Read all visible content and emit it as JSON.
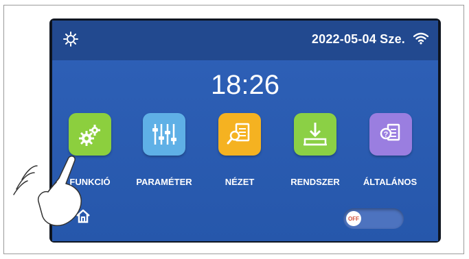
{
  "status_bar": {
    "datetime": "2022-05-04 Sze.",
    "left_icon": "sun-icon",
    "right_icon": "wifi-icon"
  },
  "clock": "18:26",
  "menu": [
    {
      "label": "FUNKCIÓ",
      "icon": "gears-icon",
      "color": "#8ccf3e"
    },
    {
      "label": "PARAMÉTER",
      "icon": "sliders-icon",
      "color": "#5fb0e6"
    },
    {
      "label": "NÉZET",
      "icon": "document-search-icon",
      "color": "#f5b221"
    },
    {
      "label": "RENDSZER",
      "icon": "download-tray-icon",
      "color": "#8bd045"
    },
    {
      "label": "ÁLTALÁNOS",
      "icon": "document-help-icon",
      "color": "#9a7ee0"
    }
  ],
  "footer": {
    "home_icon": "home-icon",
    "toggle_label": "OFF"
  },
  "colors": {
    "screen": "#2a5bb0",
    "topbar": "#22498f",
    "bezel": "#0f1520"
  }
}
